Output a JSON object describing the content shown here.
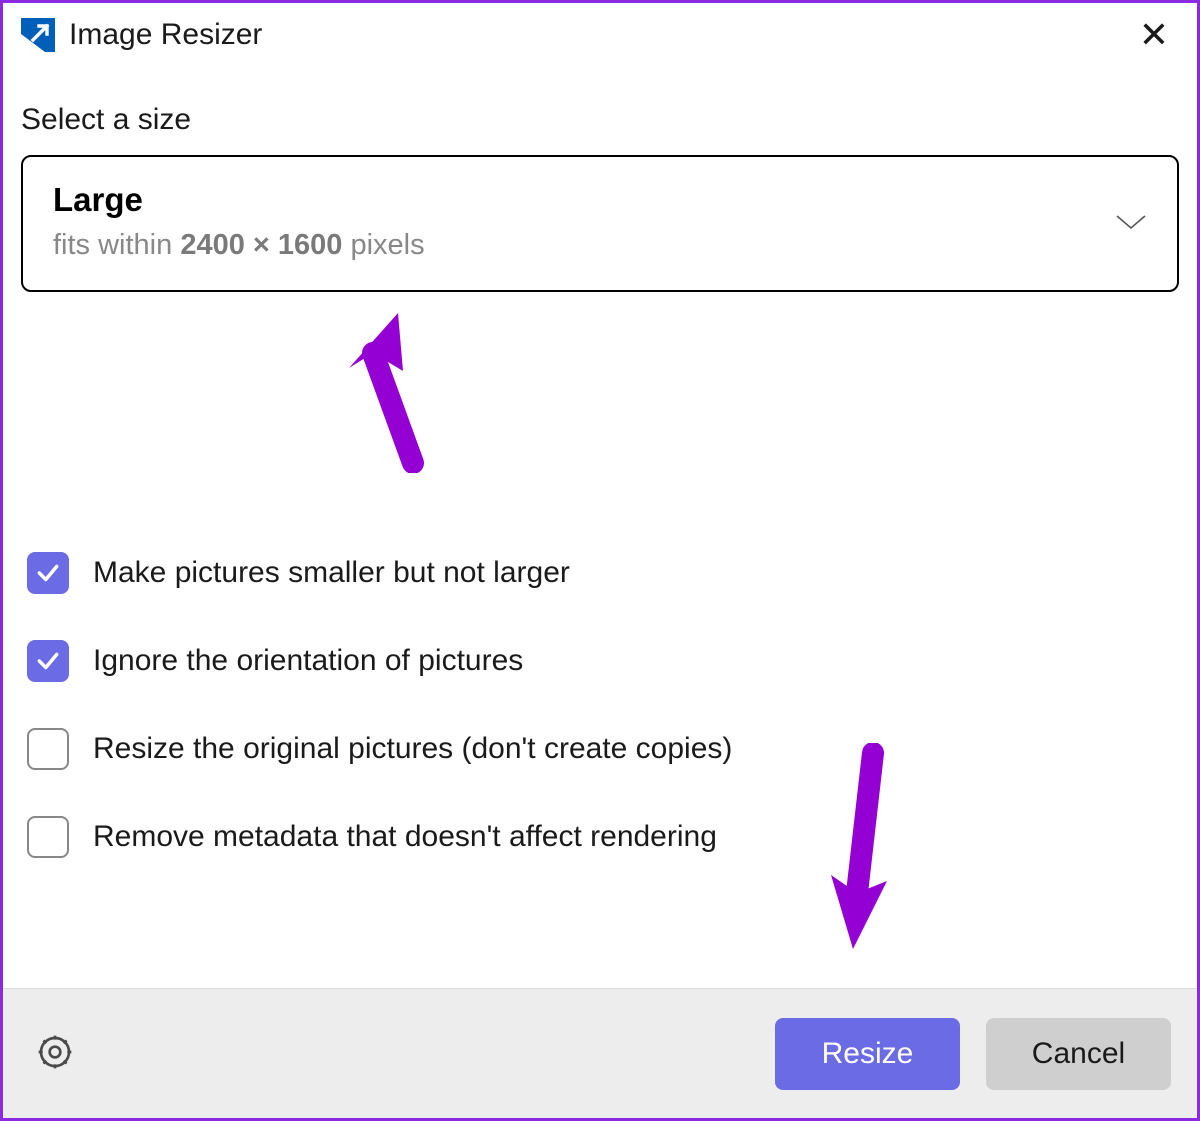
{
  "titlebar": {
    "title": "Image Resizer"
  },
  "section_label": "Select a size",
  "dropdown": {
    "selected_name": "Large",
    "desc_prefix": "fits within ",
    "width": "2400",
    "times": " × ",
    "height": "1600",
    "desc_suffix": " pixels"
  },
  "options": [
    {
      "label": "Make pictures smaller but not larger",
      "checked": true
    },
    {
      "label": "Ignore the orientation of pictures",
      "checked": true
    },
    {
      "label": "Resize the original pictures (don't create copies)",
      "checked": false
    },
    {
      "label": "Remove metadata that doesn't affect rendering",
      "checked": false
    }
  ],
  "footer": {
    "resize_label": "Resize",
    "cancel_label": "Cancel"
  }
}
